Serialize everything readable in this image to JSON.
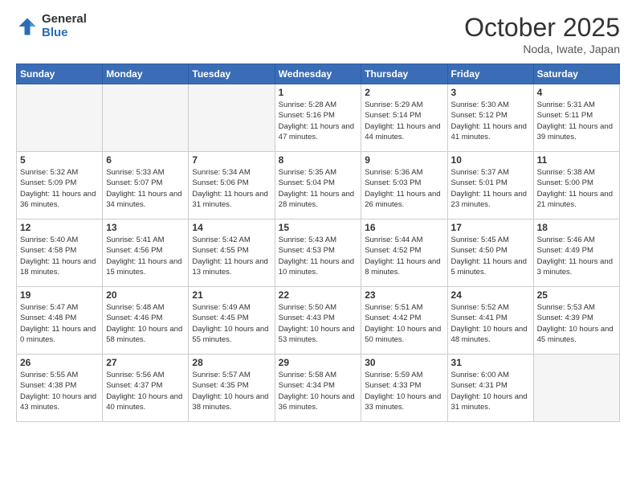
{
  "header": {
    "logo_general": "General",
    "logo_blue": "Blue",
    "month_title": "October 2025",
    "location": "Noda, Iwate, Japan"
  },
  "weekdays": [
    "Sunday",
    "Monday",
    "Tuesday",
    "Wednesday",
    "Thursday",
    "Friday",
    "Saturday"
  ],
  "weeks": [
    [
      {
        "day": "",
        "empty": true
      },
      {
        "day": "",
        "empty": true
      },
      {
        "day": "",
        "empty": true
      },
      {
        "day": "1",
        "sunrise": "5:28 AM",
        "sunset": "5:16 PM",
        "daylight": "11 hours and 47 minutes."
      },
      {
        "day": "2",
        "sunrise": "5:29 AM",
        "sunset": "5:14 PM",
        "daylight": "11 hours and 44 minutes."
      },
      {
        "day": "3",
        "sunrise": "5:30 AM",
        "sunset": "5:12 PM",
        "daylight": "11 hours and 41 minutes."
      },
      {
        "day": "4",
        "sunrise": "5:31 AM",
        "sunset": "5:11 PM",
        "daylight": "11 hours and 39 minutes."
      }
    ],
    [
      {
        "day": "5",
        "sunrise": "5:32 AM",
        "sunset": "5:09 PM",
        "daylight": "11 hours and 36 minutes."
      },
      {
        "day": "6",
        "sunrise": "5:33 AM",
        "sunset": "5:07 PM",
        "daylight": "11 hours and 34 minutes."
      },
      {
        "day": "7",
        "sunrise": "5:34 AM",
        "sunset": "5:06 PM",
        "daylight": "11 hours and 31 minutes."
      },
      {
        "day": "8",
        "sunrise": "5:35 AM",
        "sunset": "5:04 PM",
        "daylight": "11 hours and 28 minutes."
      },
      {
        "day": "9",
        "sunrise": "5:36 AM",
        "sunset": "5:03 PM",
        "daylight": "11 hours and 26 minutes."
      },
      {
        "day": "10",
        "sunrise": "5:37 AM",
        "sunset": "5:01 PM",
        "daylight": "11 hours and 23 minutes."
      },
      {
        "day": "11",
        "sunrise": "5:38 AM",
        "sunset": "5:00 PM",
        "daylight": "11 hours and 21 minutes."
      }
    ],
    [
      {
        "day": "12",
        "sunrise": "5:40 AM",
        "sunset": "4:58 PM",
        "daylight": "11 hours and 18 minutes."
      },
      {
        "day": "13",
        "sunrise": "5:41 AM",
        "sunset": "4:56 PM",
        "daylight": "11 hours and 15 minutes."
      },
      {
        "day": "14",
        "sunrise": "5:42 AM",
        "sunset": "4:55 PM",
        "daylight": "11 hours and 13 minutes."
      },
      {
        "day": "15",
        "sunrise": "5:43 AM",
        "sunset": "4:53 PM",
        "daylight": "11 hours and 10 minutes."
      },
      {
        "day": "16",
        "sunrise": "5:44 AM",
        "sunset": "4:52 PM",
        "daylight": "11 hours and 8 minutes."
      },
      {
        "day": "17",
        "sunrise": "5:45 AM",
        "sunset": "4:50 PM",
        "daylight": "11 hours and 5 minutes."
      },
      {
        "day": "18",
        "sunrise": "5:46 AM",
        "sunset": "4:49 PM",
        "daylight": "11 hours and 3 minutes."
      }
    ],
    [
      {
        "day": "19",
        "sunrise": "5:47 AM",
        "sunset": "4:48 PM",
        "daylight": "11 hours and 0 minutes."
      },
      {
        "day": "20",
        "sunrise": "5:48 AM",
        "sunset": "4:46 PM",
        "daylight": "10 hours and 58 minutes."
      },
      {
        "day": "21",
        "sunrise": "5:49 AM",
        "sunset": "4:45 PM",
        "daylight": "10 hours and 55 minutes."
      },
      {
        "day": "22",
        "sunrise": "5:50 AM",
        "sunset": "4:43 PM",
        "daylight": "10 hours and 53 minutes."
      },
      {
        "day": "23",
        "sunrise": "5:51 AM",
        "sunset": "4:42 PM",
        "daylight": "10 hours and 50 minutes."
      },
      {
        "day": "24",
        "sunrise": "5:52 AM",
        "sunset": "4:41 PM",
        "daylight": "10 hours and 48 minutes."
      },
      {
        "day": "25",
        "sunrise": "5:53 AM",
        "sunset": "4:39 PM",
        "daylight": "10 hours and 45 minutes."
      }
    ],
    [
      {
        "day": "26",
        "sunrise": "5:55 AM",
        "sunset": "4:38 PM",
        "daylight": "10 hours and 43 minutes."
      },
      {
        "day": "27",
        "sunrise": "5:56 AM",
        "sunset": "4:37 PM",
        "daylight": "10 hours and 40 minutes."
      },
      {
        "day": "28",
        "sunrise": "5:57 AM",
        "sunset": "4:35 PM",
        "daylight": "10 hours and 38 minutes."
      },
      {
        "day": "29",
        "sunrise": "5:58 AM",
        "sunset": "4:34 PM",
        "daylight": "10 hours and 36 minutes."
      },
      {
        "day": "30",
        "sunrise": "5:59 AM",
        "sunset": "4:33 PM",
        "daylight": "10 hours and 33 minutes."
      },
      {
        "day": "31",
        "sunrise": "6:00 AM",
        "sunset": "4:31 PM",
        "daylight": "10 hours and 31 minutes."
      },
      {
        "day": "",
        "empty": true
      }
    ]
  ]
}
